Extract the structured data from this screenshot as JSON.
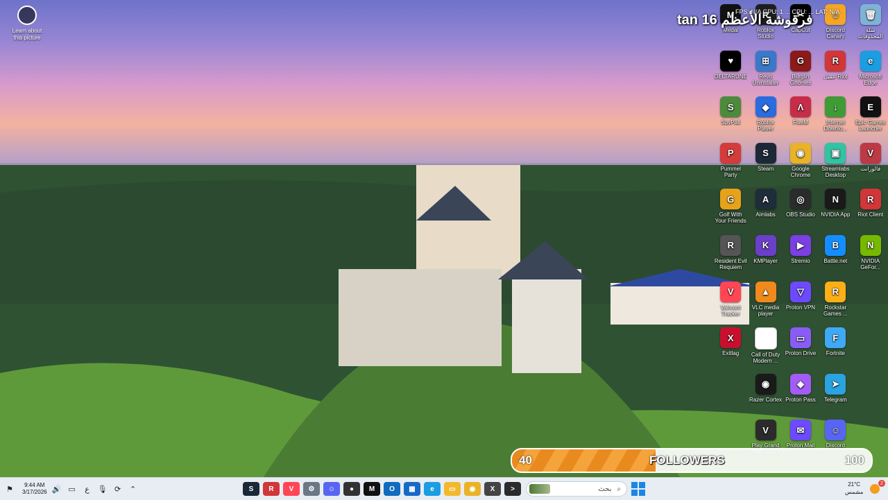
{
  "desktop": {
    "spotlight_label": "Learn about this picture",
    "overlay": {
      "title": "tan 16 فرقوشة الأعظم",
      "stats": "FPS: N/A   GPU: 1 ... CPU: ... LAT: N/A"
    },
    "icons": [
      {
        "label": "Medal",
        "color": "#111111",
        "glyph": "M"
      },
      {
        "label": "Roblox Studio",
        "color": "#1e1e1e",
        "glyph": "R"
      },
      {
        "label": "CapCut",
        "color": "#000000",
        "glyph": "✂"
      },
      {
        "label": "Discord Canary",
        "color": "#f5a623",
        "glyph": "☺"
      },
      {
        "label": "سلة المحذوفات",
        "color": "#7fb3d6",
        "glyph": "🗑"
      },
      {
        "label": "DELTARUNE",
        "color": "#000000",
        "glyph": "♥"
      },
      {
        "label": "Revo Uninstaller",
        "color": "#3a78c9",
        "glyph": "⊞"
      },
      {
        "label": "Burglin Gnomes Demo",
        "color": "#8b1a1a",
        "glyph": "G"
      },
      {
        "label": "عميل Riot",
        "color": "#d13639",
        "glyph": "R"
      },
      {
        "label": "Microsoft Edge",
        "color": "#1b9de2",
        "glyph": "e"
      },
      {
        "label": "SpyPall",
        "color": "#4b8b3b",
        "glyph": "S"
      },
      {
        "label": "Roblox Player",
        "color": "#2a6be0",
        "glyph": "◆"
      },
      {
        "label": "FiveM",
        "color": "#c72c48",
        "glyph": "Λ"
      },
      {
        "label": "Internet Downlo...",
        "color": "#3f9b35",
        "glyph": "↓"
      },
      {
        "label": "Epic Games Launcher",
        "color": "#111111",
        "glyph": "E"
      },
      {
        "label": "Pummel Party",
        "color": "#d43b3b",
        "glyph": "P"
      },
      {
        "label": "Steam",
        "color": "#1b2838",
        "glyph": "S"
      },
      {
        "label": "Google Chrome",
        "color": "#e8b327",
        "glyph": "◉"
      },
      {
        "label": "Streamlabs Desktop",
        "color": "#31c3a2",
        "glyph": "▣"
      },
      {
        "label": "فالورانت",
        "color": "#bd3944",
        "glyph": "V"
      },
      {
        "label": "Golf With Your Friends",
        "color": "#e6a21a",
        "glyph": "G"
      },
      {
        "label": "Aimlabs",
        "color": "#1f2c3a",
        "glyph": "A"
      },
      {
        "label": "OBS Studio",
        "color": "#2b2b2b",
        "glyph": "◎"
      },
      {
        "label": "NVIDIA App",
        "color": "#1a1a1a",
        "glyph": "N"
      },
      {
        "label": "Riot Client",
        "color": "#d13639",
        "glyph": "R"
      },
      {
        "label": "Resident Evil Requiem",
        "color": "#555555",
        "glyph": "R"
      },
      {
        "label": "KMPlayer",
        "color": "#6b3fc9",
        "glyph": "K"
      },
      {
        "label": "Stremio",
        "color": "#7b3fe4",
        "glyph": "▶"
      },
      {
        "label": "Battle.net",
        "color": "#148eff",
        "glyph": "B"
      },
      {
        "label": "NVIDIA GeFor...",
        "color": "#76b900",
        "glyph": "N"
      },
      {
        "label": "Valorant Tracker",
        "color": "#ff4655",
        "glyph": "V"
      },
      {
        "label": "VLC media player",
        "color": "#f08a1c",
        "glyph": "▲"
      },
      {
        "label": "Proton VPN",
        "color": "#6d4aff",
        "glyph": "▽"
      },
      {
        "label": "Rockstar Games ...",
        "color": "#fcaf17",
        "glyph": "R"
      },
      {
        "label": "",
        "color": "",
        "glyph": ""
      },
      {
        "label": "Exitlag",
        "color": "#c8102e",
        "glyph": "X"
      },
      {
        "label": "Call of Duty Modern ...",
        "color": "#ffffff",
        "glyph": ""
      },
      {
        "label": "Proton Drive",
        "color": "#8a5cf6",
        "glyph": "▭"
      },
      {
        "label": "Fortnite",
        "color": "#3fa9f5",
        "glyph": "F"
      },
      {
        "label": "",
        "color": "",
        "glyph": ""
      },
      {
        "label": "",
        "color": "",
        "glyph": ""
      },
      {
        "label": "Razer Cortex",
        "color": "#1a1a1a",
        "glyph": "◉"
      },
      {
        "label": "Proton Pass",
        "color": "#a35cf6",
        "glyph": "◆"
      },
      {
        "label": "Telegram",
        "color": "#2aa3e0",
        "glyph": "➤"
      },
      {
        "label": "",
        "color": "",
        "glyph": ""
      },
      {
        "label": "",
        "color": "",
        "glyph": ""
      },
      {
        "label": "Play Grand Theft Auto V",
        "color": "#2b2b2b",
        "glyph": "V"
      },
      {
        "label": "Proton Mail",
        "color": "#6d4aff",
        "glyph": "✉"
      },
      {
        "label": "Discord",
        "color": "#5865f2",
        "glyph": "☺"
      }
    ]
  },
  "followers": {
    "current": "40",
    "label": "FOLLOWERS",
    "goal": "100",
    "progress": 0.4,
    "fill_color": "#e98a1f"
  },
  "taskbar": {
    "time": "9:44 AM",
    "date": "3/17/2026",
    "language": "ع",
    "search_placeholder": "بحث",
    "apps": [
      {
        "name": "steam-taskbar-icon",
        "color": "#1b2838",
        "glyph": "S"
      },
      {
        "name": "riot-taskbar-icon",
        "color": "#d13639",
        "glyph": "R"
      },
      {
        "name": "valorant-tracker-taskbar-icon",
        "color": "#ff4655",
        "glyph": "V"
      },
      {
        "name": "settings-taskbar-icon",
        "color": "#6b7785",
        "glyph": "⚙"
      },
      {
        "name": "discord-taskbar-icon",
        "color": "#5865f2",
        "glyph": "☺"
      },
      {
        "name": "davinci-taskbar-icon",
        "color": "#333333",
        "glyph": "●"
      },
      {
        "name": "medal-taskbar-icon",
        "color": "#111111",
        "glyph": "M"
      },
      {
        "name": "outlook-taskbar-icon",
        "color": "#0f6cbd",
        "glyph": "O"
      },
      {
        "name": "store-taskbar-icon",
        "color": "#1769c6",
        "glyph": "▦"
      },
      {
        "name": "edge-taskbar-icon",
        "color": "#1b9de2",
        "glyph": "e"
      },
      {
        "name": "explorer-taskbar-icon",
        "color": "#f2b92d",
        "glyph": "▭"
      },
      {
        "name": "chrome-taskbar-icon",
        "color": "#e8b327",
        "glyph": "◉"
      },
      {
        "name": "xbox-taskbar-icon",
        "color": "#444444",
        "glyph": "X"
      },
      {
        "name": "terminal-taskbar-icon",
        "color": "#2b2b2b",
        "glyph": ">"
      }
    ],
    "weather_temp": "21°C",
    "weather_desc": "مشمس",
    "notification_count": "2"
  }
}
